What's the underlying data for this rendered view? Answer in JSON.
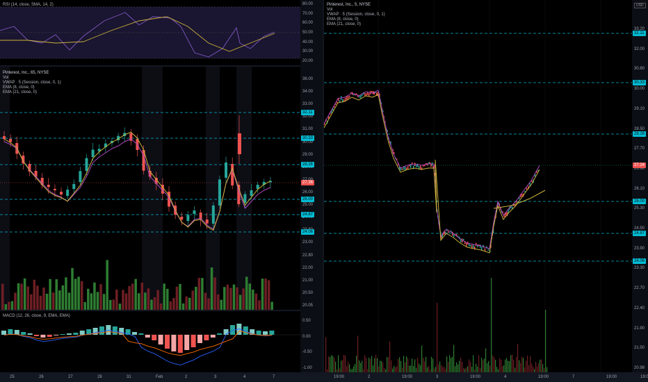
{
  "left_chart": {
    "rsi_legend": "RSI (14, close, SMA, 14, 2)",
    "main_legend": {
      "title": "Pinterest, Inc., 65, NYSE",
      "vol": "Vol",
      "vwap": "VWAP · 5 (Session, close, 0, 1)",
      "ema8": "EMA (8, close, 0)",
      "ema21": "EMA (21, close, 0)"
    },
    "macd_legend": "MACD (12, 26, close, 9, EMA, EMA)",
    "x_labels": [
      "25",
      "26",
      "27",
      "28",
      "31",
      "Feb",
      "2",
      "3",
      "4",
      "7"
    ],
    "rsi_ticks": [
      "80.00",
      "70.00",
      "60.00",
      "50.00",
      "40.00",
      "30.00",
      "20.00"
    ],
    "price_ticks": [
      "36.00",
      "34.00",
      "33.00",
      "32.00",
      "31.00",
      "30.00",
      "29.00",
      "28.00",
      "27.00",
      "26.00",
      "25.00",
      "24.40",
      "23.80",
      "23.00",
      "22.80",
      "22.00",
      "21.00",
      "20.50",
      "20.05"
    ],
    "macd_ticks": [
      "0.50",
      "0.00",
      "-0.50",
      "-1.00"
    ],
    "price_tags": [
      {
        "text": "32.11",
        "kind": "level"
      },
      {
        "text": "30.33",
        "kind": "level"
      },
      {
        "text": "28.26",
        "kind": "level"
      },
      {
        "text": "27.36",
        "kind": "last"
      },
      {
        "text": "26.00",
        "kind": "level"
      },
      {
        "text": "24.87",
        "kind": "level"
      },
      {
        "text": "24.06",
        "kind": "level"
      }
    ]
  },
  "right_chart": {
    "legend": {
      "title": "Pinterest, Inc., 5, NYSE",
      "vol": "Vol",
      "vwap": "VWAP · 5 (Session, close, 0, 1)",
      "ema8": "EMA (8, close, 0)",
      "ema21": "EMA (21, close, 0)"
    },
    "currency": "USD",
    "x_labels": [
      "19:00",
      "2",
      "19:00",
      "3",
      "19:00",
      "4",
      "19:00",
      "7",
      "19:00",
      "19:0"
    ],
    "price_ticks": [
      "33.20",
      "32.00",
      "30.80",
      "30.00",
      "29.10",
      "28.50",
      "27.70",
      "26.90",
      "26.10",
      "25.30",
      "24.50",
      "23.90",
      "23.30",
      "22.70",
      "22.40",
      "21.90",
      "21.50",
      "20.98"
    ],
    "price_tags": [
      {
        "text": "32.11",
        "kind": "level"
      },
      {
        "text": "30.33",
        "kind": "level"
      },
      {
        "text": "28.26",
        "kind": "level"
      },
      {
        "text": "27.24",
        "kind": "last"
      },
      {
        "text": "26.00",
        "kind": "level"
      },
      {
        "text": "24.87",
        "kind": "level"
      },
      {
        "text": "24.06",
        "kind": "level"
      }
    ]
  },
  "colors": {
    "background": "#000000",
    "up": "#26a69a",
    "down": "#ef5350",
    "level_line": "#00bcd4",
    "ema8": "#ab47bc",
    "ema21": "#c9b23a",
    "vwap": "#7e57c2",
    "rsi_line": "#7e57c2",
    "rsi_sma": "#c9b23a",
    "macd_line": "#2962ff",
    "signal_line": "#ff6d00"
  }
}
